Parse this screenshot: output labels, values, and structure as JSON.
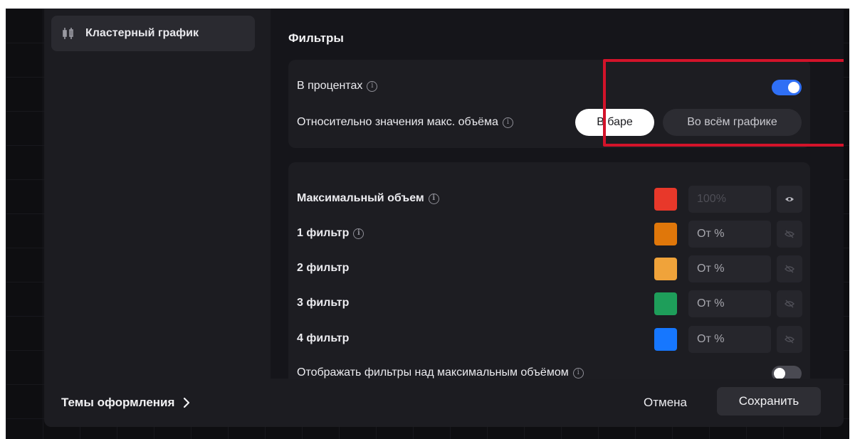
{
  "sidebar": {
    "items": [
      {
        "label": "Кластерный график",
        "icon": "candlestick-chart-icon"
      }
    ]
  },
  "main": {
    "section_title": "Фильтры",
    "percent": {
      "label": "В процентах",
      "enabled": true
    },
    "relative": {
      "label": "Относительно значения макс. объёма",
      "options": [
        "В баре",
        "Во всём графике"
      ],
      "selected": "В баре"
    },
    "filters": [
      {
        "label": "Максимальный объем",
        "info": true,
        "color": "#e8382a",
        "value": "100%",
        "visible": true,
        "disabled": true
      },
      {
        "label": "1 фильтр",
        "info": true,
        "color": "#e0770a",
        "placeholder": "От %",
        "visible": false
      },
      {
        "label": "2 фильтр",
        "info": false,
        "color": "#f0a33a",
        "placeholder": "От %",
        "visible": false
      },
      {
        "label": "3 фильтр",
        "info": false,
        "color": "#1e9e5a",
        "placeholder": "От %",
        "visible": false
      },
      {
        "label": "4 фильтр",
        "info": false,
        "color": "#1677ff",
        "placeholder": "От %",
        "visible": false
      }
    ],
    "show_above": {
      "label": "Отображать фильтры над максимальным объёмом",
      "enabled": false
    }
  },
  "footer": {
    "themes_label": "Темы оформления",
    "cancel_label": "Отмена",
    "save_label": "Сохранить"
  },
  "colors": {
    "accent": "#2f6ff5",
    "highlight": "#d3132a"
  }
}
